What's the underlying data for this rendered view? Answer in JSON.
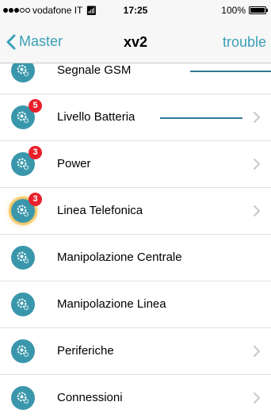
{
  "status_bar": {
    "carrier": "vodafone IT",
    "time": "17:25",
    "battery_text": "100%",
    "battery_level": 1.0,
    "signal_bars_filled": 3,
    "signal_bars_total": 5
  },
  "nav": {
    "back_label": "Master",
    "title": "xv2",
    "right_label": "trouble"
  },
  "colors": {
    "accent": "#3aa0b6",
    "icon_bg": "#3a97ab",
    "badge": "#e8202b",
    "highlight": "#f6c96b"
  },
  "list": {
    "items": [
      {
        "label": "Segnale GSM",
        "badge": "",
        "chevron": false
      },
      {
        "label": "Livello Batteria",
        "badge": "5",
        "chevron": true
      },
      {
        "label": "Power",
        "badge": "3",
        "chevron": true
      },
      {
        "label": "Linea Telefonica",
        "badge": "3",
        "chevron": true
      },
      {
        "label": "Manipolazione Centrale",
        "badge": "",
        "chevron": false
      },
      {
        "label": "Manipolazione Linea",
        "badge": "",
        "chevron": false
      },
      {
        "label": "Periferiche",
        "badge": "",
        "chevron": true
      },
      {
        "label": "Connessioni",
        "badge": "",
        "chevron": true
      }
    ]
  }
}
